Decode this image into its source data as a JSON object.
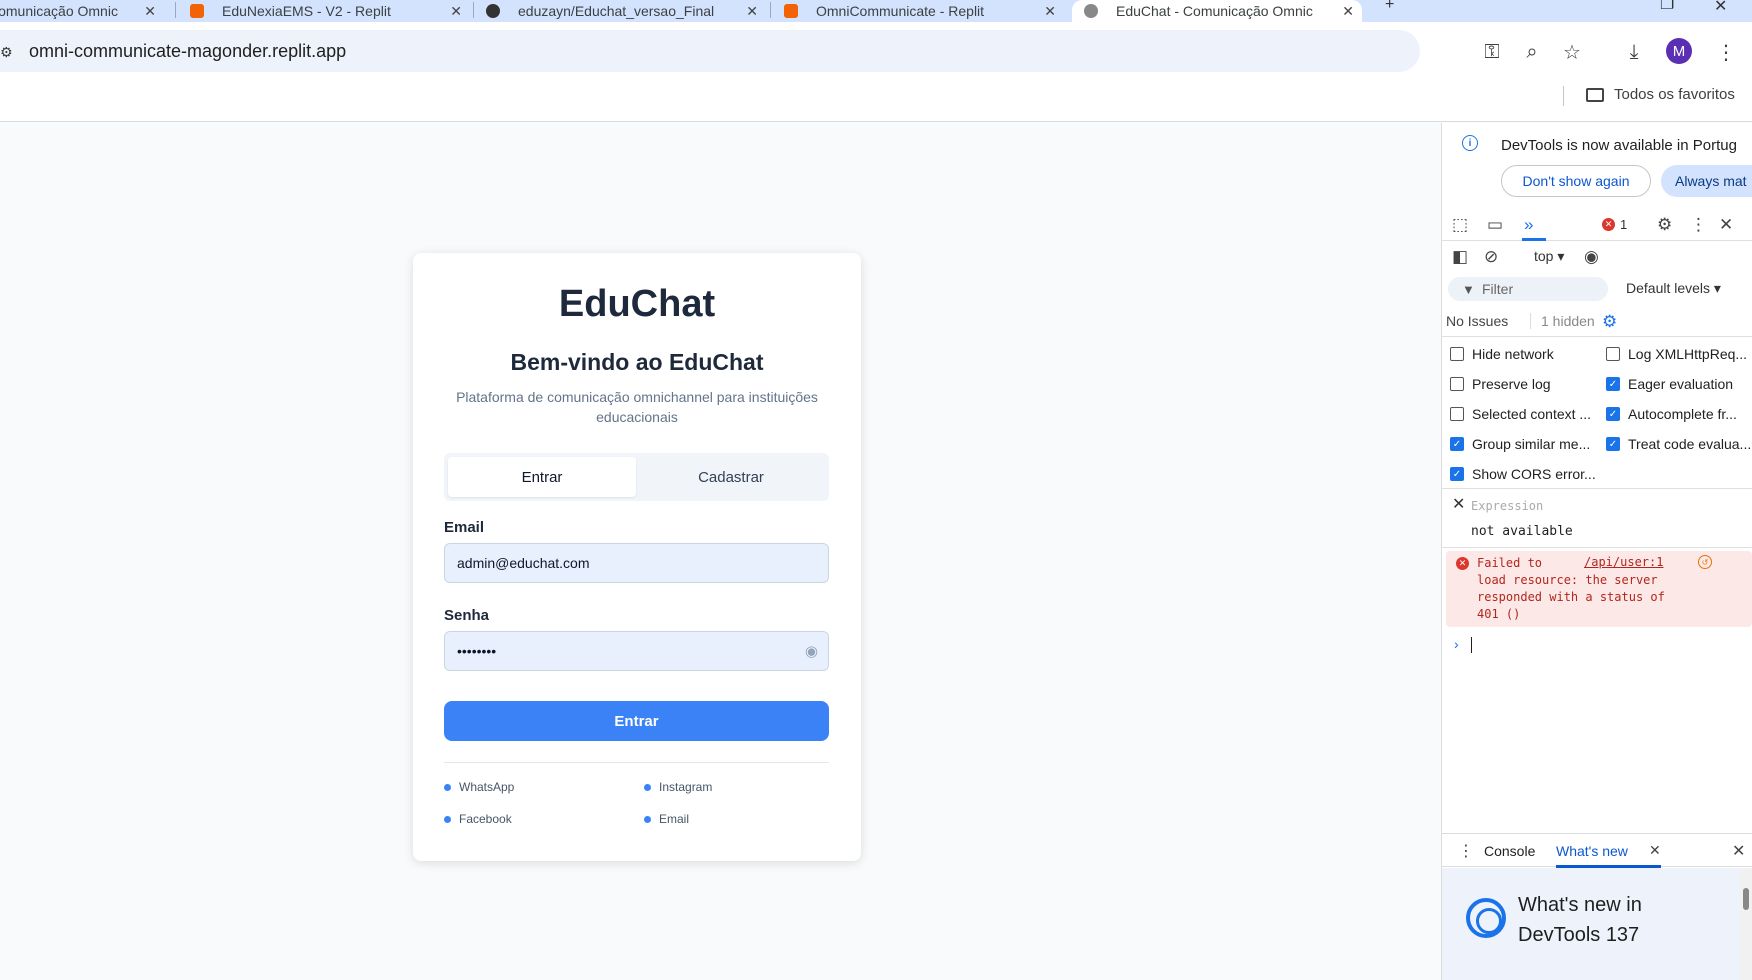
{
  "browser": {
    "tabs": [
      {
        "title": "Comunicação Omnic"
      },
      {
        "title": "EduNexiaEMS - V2 - Replit"
      },
      {
        "title": "eduzayn/Educhat_versao_Final"
      },
      {
        "title": "OmniCommunicate - Replit"
      },
      {
        "title": "EduChat - Comunicação Omnic"
      }
    ],
    "url": "omni-communicate-magonder.replit.app",
    "profile_initial": "M",
    "bookmarks_folder": "Todos os favoritos",
    "colors": {
      "tabstrip": "#d3e3fd",
      "omnibox": "#eef3fb",
      "profile": "#5b2fb4"
    }
  },
  "app": {
    "brand": "EduChat",
    "welcome": "Bem-vindo ao EduChat",
    "subtitle": "Plataforma de comunicação omnichannel para instituições educacionais",
    "tabs": {
      "login": "Entrar",
      "signup": "Cadastrar"
    },
    "email": {
      "label": "Email",
      "value": "admin@educhat.com"
    },
    "password": {
      "label": "Senha",
      "value": "••••••••"
    },
    "submit_label": "Entrar",
    "channels": [
      "WhatsApp",
      "Instagram",
      "Facebook",
      "Email"
    ],
    "colors": {
      "primary": "#3b82f6",
      "input_bg": "#e8f0fe"
    }
  },
  "devtools": {
    "banner": {
      "text": "DevTools is now available in Portug",
      "dismiss": "Don't show again",
      "always": "Always mat"
    },
    "error_count": "1",
    "context": "top ▾",
    "filter_placeholder": "Filter",
    "levels": "Default levels ▾",
    "issues": "No Issues",
    "hidden": "1 hidden",
    "settings": [
      {
        "label": "Hide network",
        "checked": false
      },
      {
        "label": "Log XMLHttpReq...",
        "checked": false
      },
      {
        "label": "Preserve log",
        "checked": false
      },
      {
        "label": "Eager evaluation",
        "checked": true
      },
      {
        "label": "Selected context ...",
        "checked": false
      },
      {
        "label": "Autocomplete fr...",
        "checked": true
      },
      {
        "label": "Group similar me...",
        "checked": true
      },
      {
        "label": "Treat code evalua...",
        "checked": true
      },
      {
        "label": "Show CORS error...",
        "checked": true
      }
    ],
    "expression": {
      "placeholder": "Expression",
      "value": "not available"
    },
    "console_error": {
      "message": "Failed to\nload resource: the server\nresponded with a status of\n401 ()",
      "link": "/api/user:1"
    },
    "drawer": {
      "tabs": [
        "Console",
        "What's new"
      ],
      "whats_new_title": "What's new in DevTools 137"
    }
  }
}
